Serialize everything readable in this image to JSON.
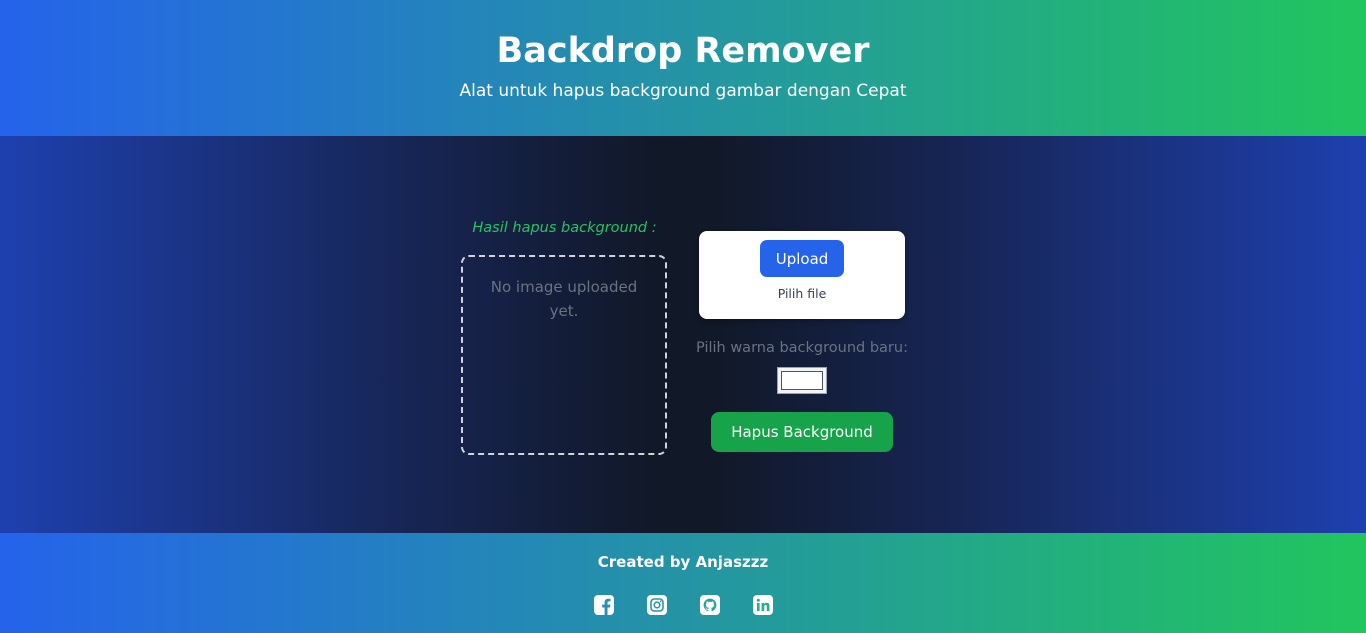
{
  "header": {
    "title": "Backdrop Remover",
    "subtitle": "Alat untuk hapus background gambar dengan Cepat"
  },
  "result": {
    "label": "Hasil hapus background :",
    "empty_text": "No image uploaded yet."
  },
  "upload": {
    "button_label": "Upload",
    "file_label": "Pilih file"
  },
  "color": {
    "label": "Pilih warna background baru:",
    "value": "#ffffff"
  },
  "remove_button_label": "Hapus Background",
  "footer": {
    "credit": "Created by  Anjaszzz",
    "social_icons": [
      "facebook-icon",
      "instagram-icon",
      "github-icon",
      "linkedin-icon"
    ]
  },
  "colors": {
    "gradient_start": "#2563eb",
    "gradient_end": "#22c55e",
    "accent_green": "#22c55e",
    "upload_button": "#2563eb",
    "remove_button": "#16a34a"
  }
}
